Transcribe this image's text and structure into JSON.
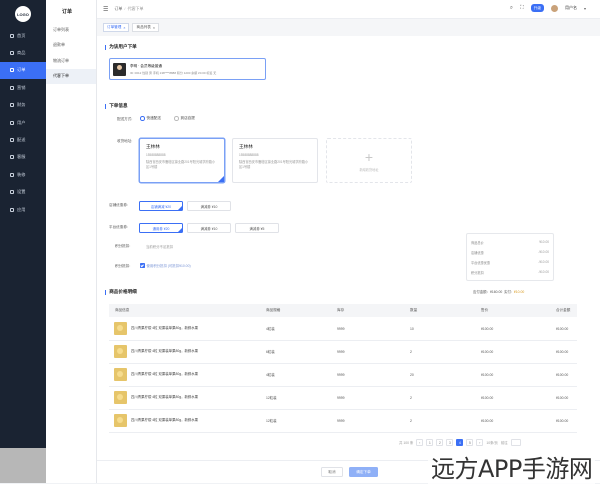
{
  "app": {
    "logo_text": "LOGO"
  },
  "sidebar": {
    "items": [
      {
        "label": "首页",
        "icon": "home-icon"
      },
      {
        "label": "商品",
        "icon": "goods-icon"
      },
      {
        "label": "订单",
        "icon": "order-icon",
        "active": true
      },
      {
        "label": "营销",
        "icon": "marketing-icon"
      },
      {
        "label": "财务",
        "icon": "finance-icon"
      },
      {
        "label": "用户",
        "icon": "user-icon"
      },
      {
        "label": "配送",
        "icon": "delivery-icon"
      },
      {
        "label": "客服",
        "icon": "service-icon"
      },
      {
        "label": "装修",
        "icon": "decorate-icon"
      },
      {
        "label": "设置",
        "icon": "settings-icon"
      },
      {
        "label": "应用",
        "icon": "apps-icon"
      }
    ]
  },
  "subnav": {
    "title": "订单",
    "items": [
      {
        "label": "订单列表"
      },
      {
        "label": "退款单"
      },
      {
        "label": "物流订单"
      },
      {
        "label": "代客下单",
        "active": true
      }
    ]
  },
  "topbar": {
    "crumb_root": "订单",
    "crumb_current": "代客下单",
    "badge": "升级",
    "user": "用户名"
  },
  "tabs": [
    {
      "label": "订单管理",
      "active": true
    },
    {
      "label": "商品列表",
      "active": false
    }
  ],
  "sections": {
    "customer": "为该用户下单",
    "order_info": "下单信息",
    "product_detail": "商品价格明细"
  },
  "customer": {
    "name": "李明 · 会员等级普通",
    "meta": "ID: 0012    性别 男    手机 138****8888    积分 1200    余额 ¥0.00    标签 无"
  },
  "order": {
    "delivery_label": "配送方式:",
    "delivery_options": [
      {
        "label": "快递配送",
        "on": true
      },
      {
        "label": "到店自提",
        "on": false
      }
    ],
    "address_label": "收货地址:",
    "addresses": [
      {
        "name": "王林林",
        "phone": "15588888888",
        "addr": "陕西省西安市雁塔区锦业路201号阳光城学府路小区1号楼",
        "selected": true
      },
      {
        "name": "王林林",
        "phone": "15588888888",
        "addr": "陕西省西安市雁塔区锦业路201号阳光城学府路小区1号楼",
        "selected": false
      }
    ],
    "add_address": "新增收货地址",
    "shop_coupon_label": "店铺优惠券:",
    "shop_coupons": [
      {
        "label": "店铺满减 ¥20",
        "selected": true
      },
      {
        "label": "满减券 ¥10",
        "selected": false
      }
    ],
    "platform_coupon_label": "平台优惠券:",
    "platform_coupons": [
      {
        "label": "通用券 ¥20",
        "selected": true
      },
      {
        "label": "满减券 ¥10",
        "selected": false
      },
      {
        "label": "满减券 ¥5",
        "selected": false
      }
    ],
    "points_label": "积分抵扣:",
    "points_text": "当前积分不足抵扣",
    "balance_label": "积分抵扣:",
    "balance_text": "使用积分抵扣 (可抵扣¥10.00)"
  },
  "fees": [
    {
      "label": "商品总价",
      "value": "¥10.00"
    },
    {
      "label": "店铺优惠",
      "value": "-¥10.00"
    },
    {
      "label": "平台优惠优惠",
      "value": "-¥10.00"
    },
    {
      "label": "积分抵扣",
      "value": "-¥10.00"
    }
  ],
  "fee_summary": {
    "label": "应付金额：¥160.00",
    "revenue_label": "实付:",
    "revenue": "¥10.00"
  },
  "table": {
    "headers": [
      "商品信息",
      "商品规格",
      "库存",
      "数量",
      "售价",
      "合计金额"
    ],
    "rows": [
      {
        "name": "四川青果柠檬 4粒 双果装单果80g，新鲜水果",
        "spec": "4粒装",
        "stock": "9999",
        "qty": "10",
        "price": "¥100.00",
        "total": "¥100.00"
      },
      {
        "name": "四川青果柠檬 4粒 双果装单果80g，新鲜水果",
        "spec": "6粒装",
        "stock": "9999",
        "qty": "2",
        "price": "¥100.00",
        "total": "¥100.00"
      },
      {
        "name": "四川青果柠檬 4粒 双果装单果80g，新鲜水果",
        "spec": "4粒装",
        "stock": "9999",
        "qty": "20",
        "price": "¥100.00",
        "total": "¥100.00"
      },
      {
        "name": "四川青果柠檬 4粒 双果装单果80g，新鲜水果",
        "spec": "12粒装",
        "stock": "9999",
        "qty": "2",
        "price": "¥100.00",
        "total": "¥100.00"
      },
      {
        "name": "四川青果柠檬 4粒 双果装单果80g，新鲜水果",
        "spec": "12粒装",
        "stock": "9999",
        "qty": "2",
        "price": "¥100.00",
        "total": "¥100.00"
      }
    ]
  },
  "pager": {
    "total": "共 100 条",
    "pages": [
      "1",
      "2",
      "3",
      "4",
      "5"
    ],
    "current": "4",
    "size": "10条/页",
    "goto": "前往"
  },
  "footer": {
    "cancel": "取消",
    "submit": "确定下单"
  },
  "watermark": "远方APP手游网"
}
